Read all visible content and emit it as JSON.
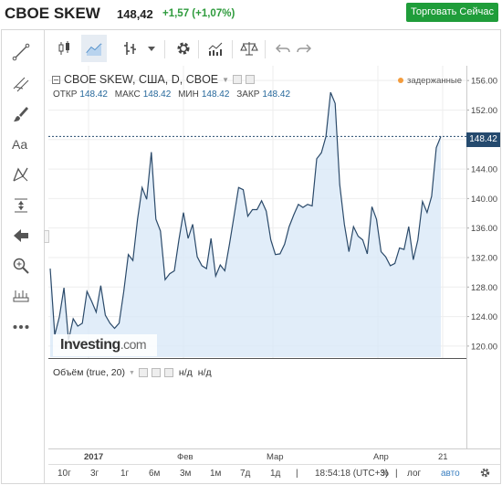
{
  "header": {
    "title": "CBOE SKEW",
    "price": "148,42",
    "change": "+1,57 (+1,07%)",
    "trade_button": "Торговать Сейчас"
  },
  "legend": {
    "instrument": "CBOE SKEW, США, D, CBOE",
    "open_label": "ОТКР",
    "open_value": "148.42",
    "high_label": "МАКС",
    "high_value": "148.42",
    "low_label": "МИН",
    "low_value": "148.42",
    "close_label": "ЗАКР",
    "close_value": "148.42",
    "delayed": "задержанные"
  },
  "price_tag": "148.42",
  "watermark": {
    "brand": "Investing",
    "suffix": ".com"
  },
  "volume_legend": {
    "label": "Объём (true, 20)",
    "na1": "н/д",
    "na2": "н/д"
  },
  "bottom_bar": {
    "ranges": [
      "10г",
      "3г",
      "1г",
      "6м",
      "3м",
      "1м",
      "7д",
      "1д"
    ],
    "time": "18:54:18 (UTC+3)",
    "percent": "%",
    "log": "лог",
    "auto": "авто"
  },
  "colors": {
    "accent": "#1f9d3a",
    "line": "#2b4a6a",
    "fill": "#d7e7f7",
    "price_tag": "#254a6e",
    "positive": "#2e9b3c"
  },
  "icons": {
    "left_toolbar": [
      "trendline-icon",
      "fib-icon",
      "brush-icon",
      "text-icon",
      "pattern-icon",
      "measure-icon",
      "back-arrow-icon",
      "zoom-icon",
      "ruler-icon",
      "more-icon"
    ],
    "top_toolbar": [
      "candles-icon",
      "area-chart-icon",
      "bars-icon",
      "dropdown-icon",
      "settings-icon",
      "indicators-icon",
      "compare-icon",
      "undo-icon",
      "redo-icon"
    ]
  },
  "chart_data": {
    "type": "area",
    "title": "CBOE SKEW",
    "xlabel": "",
    "ylabel": "",
    "x_ticks": [
      "2017",
      "Фев",
      "Мар",
      "Апр",
      "21"
    ],
    "y_ticks": [
      120,
      124,
      128,
      132,
      136,
      140,
      144,
      148,
      152,
      156
    ],
    "ylim": [
      118.5,
      158.0
    ],
    "last_value": 148.42,
    "values": [
      130.5,
      121.5,
      124.0,
      127.9,
      120.8,
      123.7,
      122.7,
      123.1,
      127.4,
      126.1,
      124.6,
      128.2,
      124.2,
      123.1,
      122.4,
      123.1,
      127.4,
      132.4,
      131.6,
      137.2,
      141.5,
      139.9,
      146.3,
      137.2,
      135.6,
      129.0,
      129.8,
      130.2,
      134.4,
      138.1,
      134.6,
      136.5,
      132.1,
      130.9,
      130.5,
      134.6,
      129.5,
      131.0,
      130.2,
      133.8,
      137.6,
      141.5,
      141.2,
      137.6,
      138.5,
      138.5,
      139.7,
      138.3,
      134.4,
      132.4,
      132.5,
      133.8,
      136.2,
      137.8,
      139.2,
      138.8,
      139.2,
      139.0,
      145.4,
      146.2,
      148.4,
      154.4,
      152.9,
      141.9,
      136.5,
      132.8,
      136.2,
      134.9,
      134.4,
      132.5,
      138.9,
      137.2,
      132.8,
      132.1,
      130.9,
      131.2,
      133.3,
      133.1,
      136.2,
      131.7,
      134.4,
      139.6,
      138.1,
      140.3,
      146.9,
      148.42
    ]
  }
}
